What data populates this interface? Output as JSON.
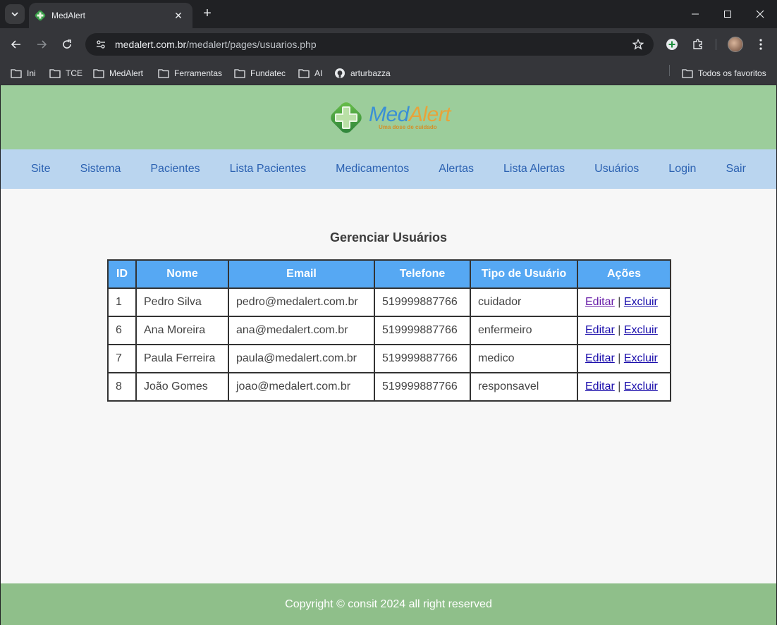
{
  "browser": {
    "tab_title": "MedAlert",
    "url_host": "medalert.com.br",
    "url_path": "/medalert/pages/usuarios.php",
    "bookmarks": [
      {
        "label": "Ini",
        "icon": "folder-icon"
      },
      {
        "label": "TCE",
        "icon": "folder-icon"
      },
      {
        "label": "MedAlert",
        "icon": "folder-icon"
      },
      {
        "label": "Ferramentas",
        "icon": "folder-icon"
      },
      {
        "label": "Fundatec",
        "icon": "folder-icon"
      },
      {
        "label": "AI",
        "icon": "folder-icon"
      },
      {
        "label": "arturbazza",
        "icon": "github-icon"
      }
    ],
    "all_bookmarks": "Todos os favoritos"
  },
  "header": {
    "logo_med": "Med",
    "logo_alert": "Alert",
    "logo_tagline": "Uma dose de cuidado",
    "colors": {
      "header_bg": "#9ccd9b",
      "nav_bg": "#bad5ef",
      "footer_bg": "#8fbf8a",
      "table_header": "#56a8f3"
    }
  },
  "nav": {
    "items": [
      "Site",
      "Sistema",
      "Pacientes",
      "Lista Pacientes",
      "Medicamentos",
      "Alertas",
      "Lista Alertas",
      "Usuários",
      "Login",
      "Sair"
    ]
  },
  "main": {
    "title": "Gerenciar Usuários",
    "table": {
      "headers": [
        "ID",
        "Nome",
        "Email",
        "Telefone",
        "Tipo de Usuário",
        "Ações"
      ],
      "rows": [
        {
          "id": "1",
          "nome": "Pedro Silva",
          "email": "pedro@medalert.com.br",
          "telefone": "519999887766",
          "tipo": "cuidador",
          "edit": "Editar",
          "sep": "|",
          "delete": "Excluir"
        },
        {
          "id": "6",
          "nome": "Ana Moreira",
          "email": "ana@medalert.com.br",
          "telefone": "519999887766",
          "tipo": "enfermeiro",
          "edit": "Editar",
          "sep": "|",
          "delete": "Excluir"
        },
        {
          "id": "7",
          "nome": "Paula Ferreira",
          "email": "paula@medalert.com.br",
          "telefone": "519999887766",
          "tipo": "medico",
          "edit": "Editar",
          "sep": "|",
          "delete": "Excluir"
        },
        {
          "id": "8",
          "nome": "João Gomes",
          "email": "joao@medalert.com.br",
          "telefone": "519999887766",
          "tipo": "responsavel",
          "edit": "Editar",
          "sep": "|",
          "delete": "Excluir"
        }
      ]
    }
  },
  "footer": {
    "text": "Copyright © consit 2024 all right reserved"
  }
}
